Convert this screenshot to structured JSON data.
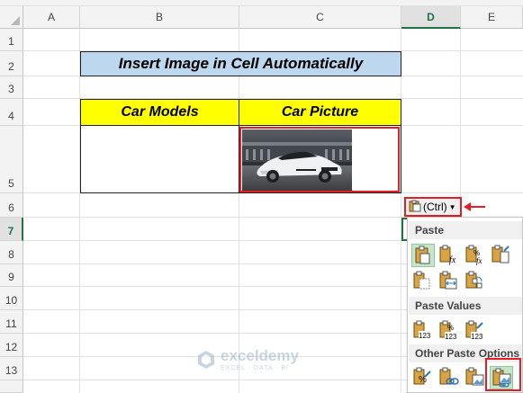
{
  "columns": [
    "A",
    "B",
    "C",
    "D",
    "E"
  ],
  "rows": [
    "1",
    "2",
    "3",
    "4",
    "5",
    "6",
    "7",
    "8",
    "9",
    "10",
    "11",
    "12",
    "13"
  ],
  "active_cell": "D7",
  "sheet": {
    "title": "Insert Image in Cell Automatically",
    "header_models": "Car Models",
    "header_picture": "Car Picture",
    "picture_alt": "white sports car"
  },
  "paste_button": {
    "label": "(Ctrl)",
    "icon": "clipboard-icon"
  },
  "paste_menu": {
    "section_paste": "Paste",
    "section_values": "Paste Values",
    "section_other": "Other Paste Options",
    "paste_icons": [
      "paste-icon",
      "paste-formulas-icon",
      "paste-formulas-number-format-icon",
      "paste-keep-source-formatting-icon",
      "paste-no-borders-icon",
      "paste-keep-column-widths-icon",
      "paste-transpose-icon"
    ],
    "values_icons": [
      "paste-values-icon",
      "paste-values-number-format-icon",
      "paste-values-source-formatting-icon"
    ],
    "other_icons": [
      "paste-formatting-icon",
      "paste-link-icon",
      "paste-picture-icon",
      "paste-linked-picture-icon"
    ],
    "num_label": "123",
    "pct_label": "%",
    "fx_label": "fx"
  },
  "watermark": {
    "name": "exceldemy",
    "tagline": "EXCEL · DATA · BI"
  },
  "colors": {
    "title_fill": "#bdd7ee",
    "header_fill": "#ffff00",
    "highlight_red": "#e31e24",
    "excel_green": "#217346"
  }
}
